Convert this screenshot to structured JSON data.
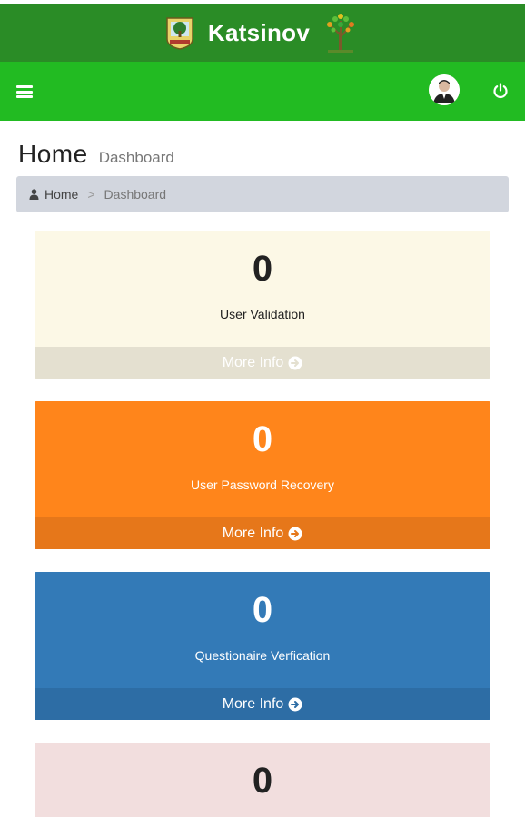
{
  "app": {
    "name": "Katsinov"
  },
  "header": {
    "title": "Home",
    "subtitle": "Dashboard"
  },
  "breadcrumb": {
    "home": "Home",
    "separator": ">",
    "current": "Dashboard"
  },
  "icons": {
    "menu": "hamburger-icon",
    "profile": "avatar",
    "logout": "power-icon",
    "home": "user-icon",
    "more": "arrow-circle-right-icon"
  },
  "boxes": [
    {
      "count": "0",
      "label": "User Validation",
      "more": "More Info",
      "color": "#fcf8e6"
    },
    {
      "count": "0",
      "label": "User Password Recovery",
      "more": "More Info",
      "color": "#ff851b"
    },
    {
      "count": "0",
      "label": "Questionaire Verfication",
      "more": "More Info",
      "color": "#337ab7"
    },
    {
      "count": "0",
      "color": "#f2dede"
    }
  ],
  "colors": {
    "topbar": "#2a8c26",
    "navbar": "#22bb22",
    "breadcrumb_bg": "#d2d6de"
  }
}
